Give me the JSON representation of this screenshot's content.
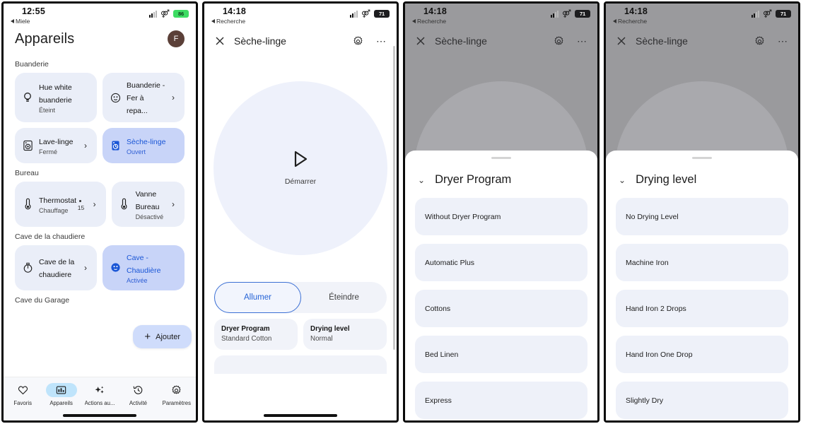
{
  "panel1": {
    "status": {
      "time": "12:55",
      "back_label": "Miele",
      "battery": "86",
      "battery_style": "green"
    },
    "header": {
      "title": "Appareils",
      "avatar_initial": "F"
    },
    "sections": [
      {
        "label": "Buanderie",
        "cards": [
          {
            "name": "Hue white buanderie",
            "sub": "Éteint",
            "icon": "bulb-icon",
            "chevron": false,
            "active": false
          },
          {
            "name": "Buanderie - Fer à repa...",
            "sub": "",
            "icon": "outlet-icon",
            "chevron": true,
            "active": false
          },
          {
            "name": "Lave-linge",
            "sub": "Fermé",
            "icon": "washer-icon",
            "chevron": true,
            "active": false
          },
          {
            "name": "Sèche-linge",
            "sub": "Ouvert",
            "icon": "dryer-icon",
            "chevron": false,
            "active": true
          }
        ]
      },
      {
        "label": "Bureau",
        "cards": [
          {
            "name": "Thermostat",
            "sub": "Chauffage",
            "value": "15",
            "icon": "thermostat-icon",
            "chevron": true,
            "active": false
          },
          {
            "name": "Vanne Bureau",
            "sub": "Désactivé",
            "icon": "thermostat-icon",
            "chevron": true,
            "active": false
          }
        ]
      },
      {
        "label": "Cave de la chaudiere",
        "cards": [
          {
            "name": "Cave de la chaudiere",
            "sub": "",
            "icon": "valve-icon",
            "chevron": true,
            "active": false
          },
          {
            "name": "Cave - Chaudière",
            "sub": "Activée",
            "icon": "outlet-icon",
            "chevron": false,
            "active": true
          }
        ]
      },
      {
        "label": "Cave du Garage",
        "cards": []
      }
    ],
    "add_popup": {
      "label": "Ajouter",
      "icon": "plus-icon"
    },
    "tabbar": [
      {
        "label": "Favoris",
        "icon": "heart-icon",
        "selected": false
      },
      {
        "label": "Appareils",
        "icon": "devices-icon",
        "selected": true
      },
      {
        "label": "Actions au...",
        "icon": "sparkle-icon",
        "selected": false
      },
      {
        "label": "Activité",
        "icon": "history-icon",
        "selected": false
      },
      {
        "label": "Paramètres",
        "icon": "gear-icon",
        "selected": false
      }
    ]
  },
  "panel2": {
    "status": {
      "time": "14:18",
      "back_label": "Recherche",
      "battery": "71",
      "battery_style": "dark"
    },
    "appbar": {
      "title": "Sèche-linge",
      "close_icon": "close-icon",
      "settings_icon": "gear-icon",
      "more_icon": "more-icon"
    },
    "dial": {
      "label": "Démarrer",
      "icon": "play-icon"
    },
    "segmented": {
      "on_label": "Allumer",
      "off_label": "Éteindre",
      "selected": "Allumer"
    },
    "tiles": [
      {
        "title": "Dryer Program",
        "value": "Standard Cotton"
      },
      {
        "title": "Drying level",
        "value": "Normal"
      }
    ]
  },
  "panel3": {
    "status": {
      "time": "14:18",
      "back_label": "Recherche",
      "battery": "71",
      "battery_style": "dark"
    },
    "appbar": {
      "title": "Sèche-linge",
      "close_icon": "close-icon",
      "settings_icon": "gear-icon",
      "more_icon": "more-icon"
    },
    "dial": {
      "icon": "play-icon"
    },
    "sheet": {
      "title": "Dryer Program",
      "caret": "chevron-down-icon",
      "options": [
        "Without Dryer Program",
        "Automatic Plus",
        "Cottons",
        "Bed Linen",
        "Express"
      ]
    }
  },
  "panel4": {
    "status": {
      "time": "14:18",
      "back_label": "Recherche",
      "battery": "71",
      "battery_style": "dark"
    },
    "appbar": {
      "title": "Sèche-linge",
      "close_icon": "close-icon",
      "settings_icon": "gear-icon",
      "more_icon": "more-icon"
    },
    "dial": {
      "icon": "play-icon"
    },
    "sheet": {
      "title": "Drying level",
      "caret": "chevron-down-icon",
      "options": [
        "No Drying Level",
        "Machine Iron",
        "Hand Iron 2 Drops",
        "Hand Iron One Drop",
        "Slightly Dry"
      ]
    }
  },
  "colors": {
    "accent_blue": "#1a56d6",
    "card_bg": "#eaeef8",
    "card_active_bg": "#c8d4f8",
    "tab_selected_pill": "#bfe4fb",
    "battery_green": "#3ddc63"
  }
}
